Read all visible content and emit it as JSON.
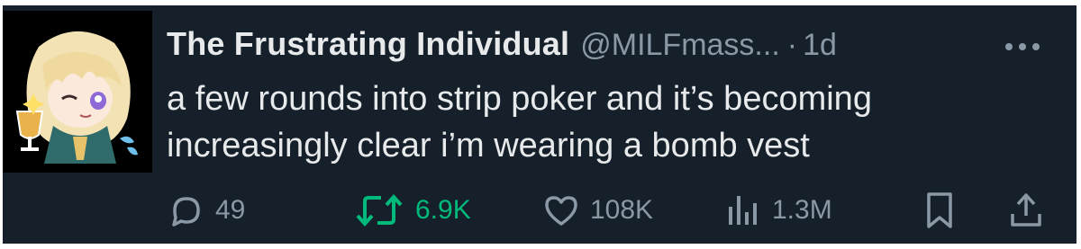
{
  "tweet": {
    "display_name": "The Frustrating Individual",
    "handle": "@MILFmass...",
    "separator": "·",
    "time": "1d",
    "text_line1": "a few rounds into strip poker and it’s becoming",
    "text_line2": "increasingly clear i’m wearing a bomb vest"
  },
  "actions": {
    "replies": "49",
    "reposts": "6.9K",
    "likes": "108K",
    "views": "1.3M"
  },
  "icons": {
    "reply": "reply-bubble-icon",
    "repost": "repost-arrows-icon",
    "like": "heart-icon",
    "views": "bar-chart-icon",
    "bookmark": "bookmark-icon",
    "share": "share-upload-icon",
    "more": "more-dots-icon"
  },
  "colors": {
    "background": "#15202b",
    "text": "#e7e9ea",
    "secondary": "#8b98a5",
    "repost_active": "#00ba7c"
  }
}
